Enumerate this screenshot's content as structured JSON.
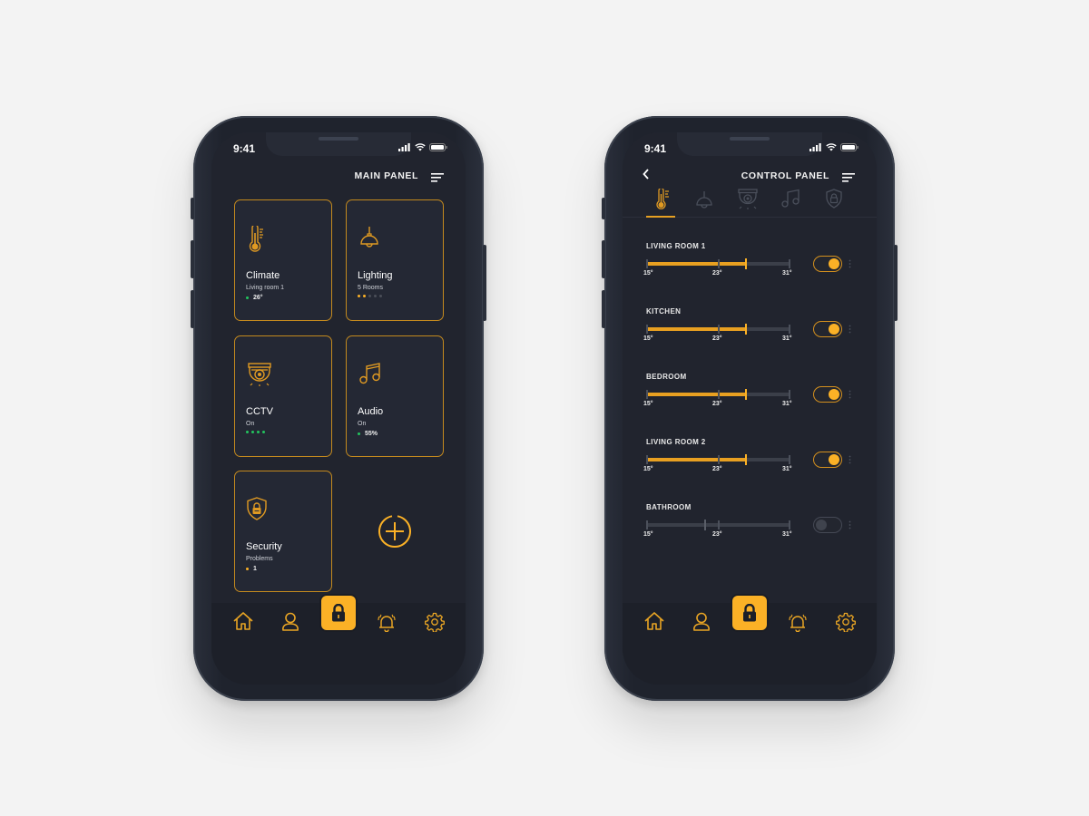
{
  "colors": {
    "accent": "#fbb126",
    "accent_border": "#c48a1e",
    "screen_bg": "#21242e",
    "status_green": "#22c55e",
    "inactive_icon": "#4a4f5b"
  },
  "left_phone": {
    "status": {
      "time": "9:41"
    },
    "header": {
      "title": "MAIN PANEL",
      "menu_icon": "menu-icon"
    },
    "cards": [
      {
        "title": "Climate",
        "subtitle": "Living room 1",
        "value": "26°",
        "icon": "thermometer-icon",
        "indicator": "green-dot"
      },
      {
        "title": "Lighting",
        "subtitle": "5 Rooms",
        "value": "",
        "icon": "ceiling-lamp-icon",
        "indicator": "2 of 5 dots active"
      },
      {
        "title": "CCTV",
        "subtitle": "On",
        "value": "",
        "icon": "cctv-camera-icon",
        "indicator": "4 green dots"
      },
      {
        "title": "Audio",
        "subtitle": "On",
        "value": "55%",
        "icon": "music-note-icon",
        "indicator": "green-dot"
      },
      {
        "title": "Security",
        "subtitle": "Problems",
        "value": "1",
        "icon": "shield-lock-icon",
        "indicator": "yellow-dot"
      }
    ],
    "add_button": {
      "icon": "add-circle-icon"
    },
    "bottom_nav": [
      {
        "icon": "home-icon",
        "active": false
      },
      {
        "icon": "user-icon",
        "active": false
      },
      {
        "icon": "lock-icon",
        "active": true
      },
      {
        "icon": "alarm-bell-icon",
        "active": false
      },
      {
        "icon": "gear-icon",
        "active": false
      }
    ]
  },
  "right_phone": {
    "status": {
      "time": "9:41"
    },
    "header": {
      "title": "CONTROL PANEL",
      "back_icon": "back-chevron-icon",
      "menu_icon": "menu-icon"
    },
    "tabs": [
      {
        "icon": "thermometer-icon",
        "active": true
      },
      {
        "icon": "ceiling-lamp-icon",
        "active": false
      },
      {
        "icon": "cctv-camera-icon",
        "active": false
      },
      {
        "icon": "music-note-icon",
        "active": false
      },
      {
        "icon": "shield-lock-icon",
        "active": false
      }
    ],
    "slider_scale": {
      "min_label": "15°",
      "mid_label": "23°",
      "max_label": "31°",
      "min": 15,
      "max": 31
    },
    "rooms": [
      {
        "name": "LIVING ROOM 1",
        "setpoint": 26,
        "enabled": true
      },
      {
        "name": "KITCHEN",
        "setpoint": 26,
        "enabled": true
      },
      {
        "name": "BEDROOM",
        "setpoint": 26,
        "enabled": true
      },
      {
        "name": "LIVING ROOM 2",
        "setpoint": 26,
        "enabled": true
      },
      {
        "name": "BATHROOM",
        "setpoint": 21.5,
        "enabled": false
      }
    ],
    "bottom_nav": [
      {
        "icon": "home-icon",
        "active": false
      },
      {
        "icon": "user-icon",
        "active": false
      },
      {
        "icon": "lock-icon",
        "active": true
      },
      {
        "icon": "alarm-bell-icon",
        "active": false
      },
      {
        "icon": "gear-icon",
        "active": false
      }
    ]
  }
}
